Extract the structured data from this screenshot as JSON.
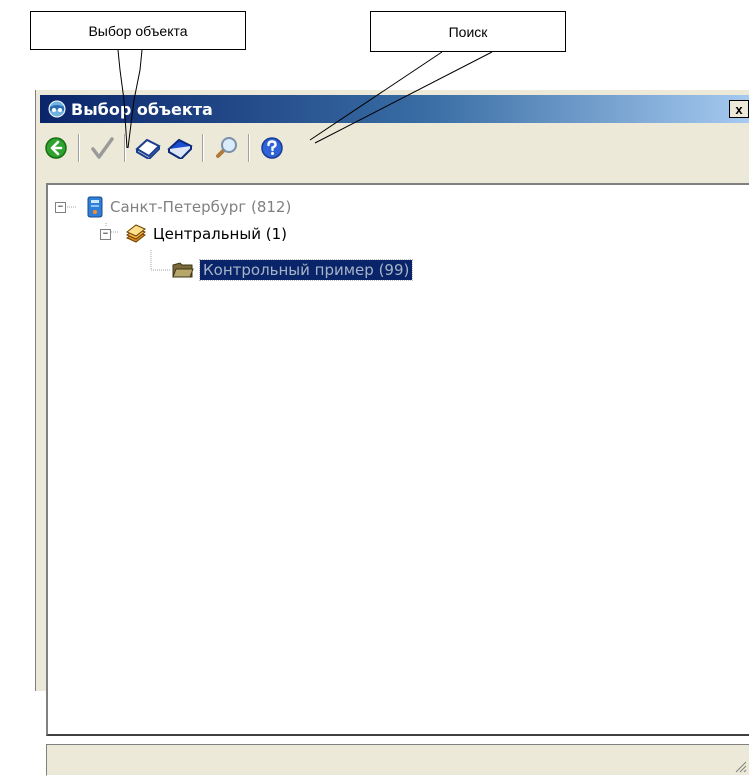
{
  "callouts": {
    "select": "Выбор объекта",
    "search": "Поиск"
  },
  "window": {
    "title": "Выбор объекта",
    "close_label": "x",
    "title_icon": "binoculars-globe-icon"
  },
  "toolbar": {
    "buttons": [
      {
        "name": "back-button",
        "icon": "green-arrow-left-icon"
      },
      {
        "name": "select-button",
        "icon": "checkmark-icon"
      },
      {
        "name": "open-book-button",
        "icon": "open-book-icon"
      },
      {
        "name": "closed-book-button",
        "icon": "blue-book-icon"
      },
      {
        "name": "search-button",
        "icon": "magnifier-icon"
      },
      {
        "name": "help-button",
        "icon": "help-icon"
      }
    ]
  },
  "tree": {
    "root": {
      "label": "Санкт-Петербург (812)",
      "icon": "server-icon",
      "expander": "−"
    },
    "child": {
      "label": "Центральный (1)",
      "icon": "stack-icon",
      "expander": "−"
    },
    "leaf": {
      "label": "Контрольный пример (99)",
      "icon": "folder-icon",
      "selected": true
    }
  },
  "colors": {
    "title_start": "#0a246a",
    "title_end": "#a6caf0",
    "selection": "#0a246a",
    "window_bg": "#ece9d8"
  }
}
